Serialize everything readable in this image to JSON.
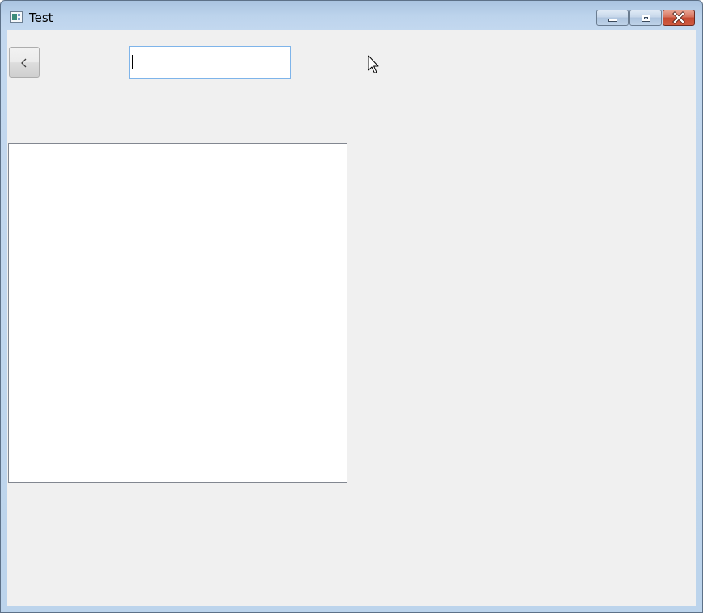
{
  "window": {
    "title": "Test",
    "icon": "app-window-icon",
    "controls": {
      "minimize_icon": "minimize-icon",
      "maximize_icon": "maximize-icon",
      "close_icon": "close-icon"
    }
  },
  "toolbar": {
    "back_icon": "chevron-left-icon",
    "input_value": ""
  },
  "colors": {
    "title_bar": "#bcd3ec",
    "client_background": "#f0f0f0",
    "close_button": "#c44a32",
    "input_border": "#7eb4ea",
    "panel_border": "#828790"
  }
}
